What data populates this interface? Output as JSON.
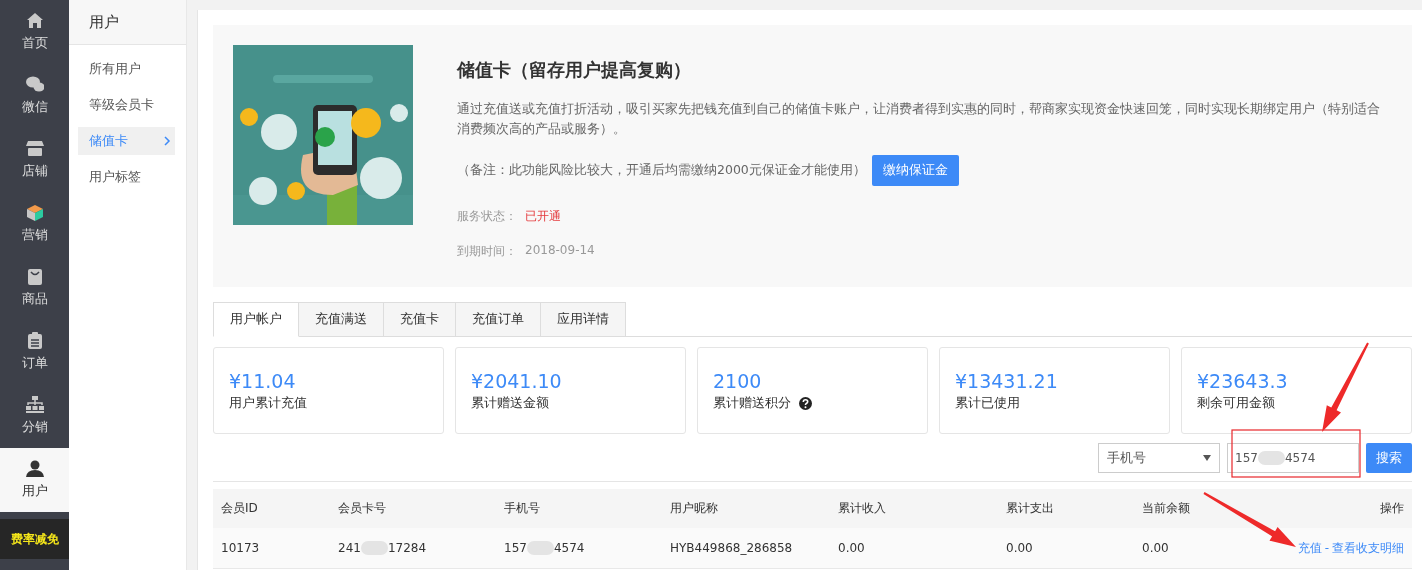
{
  "nav": [
    {
      "label": "首页",
      "selected": false
    },
    {
      "label": "微信",
      "selected": false
    },
    {
      "label": "店铺",
      "selected": false
    },
    {
      "label": "营销",
      "selected": false
    },
    {
      "label": "商品",
      "selected": false
    },
    {
      "label": "订单",
      "selected": false
    },
    {
      "label": "分销",
      "selected": false
    },
    {
      "label": "用户",
      "selected": true
    }
  ],
  "promo": {
    "label": "费率减免"
  },
  "subnav": {
    "title": "用户",
    "items": [
      {
        "label": "所有用户",
        "selected": false
      },
      {
        "label": "等级会员卡",
        "selected": false
      },
      {
        "label": "储值卡",
        "selected": true
      },
      {
        "label": "用户标签",
        "selected": false
      }
    ]
  },
  "intro": {
    "title": "储值卡（留存用户提高复购）",
    "description": "通过充值送或充值打折活动，吸引买家先把钱充值到自己的储值卡账户，让消费者得到实惠的同时，帮商家实现资金快速回笼，同时实现长期绑定用户（特别适合消费频次高的产品或服务）。",
    "note": "（备注：此功能风险比较大，开通后均需缴纳2000元保证金才能使用）",
    "pay_button": "缴纳保证金",
    "status_label": "服务状态：",
    "status_value": "已开通",
    "expiry_label": "到期时间：",
    "expiry_value": "2018-09-14"
  },
  "tabs": [
    {
      "label": "用户帐户",
      "selected": true
    },
    {
      "label": "充值满送",
      "selected": false
    },
    {
      "label": "充值卡",
      "selected": false
    },
    {
      "label": "充值订单",
      "selected": false
    },
    {
      "label": "应用详情",
      "selected": false
    }
  ],
  "stats": [
    {
      "value": "¥11.04",
      "label": "用户累计充值",
      "help": false
    },
    {
      "value": "¥2041.10",
      "label": "累计赠送金额",
      "help": false
    },
    {
      "value": "2100",
      "label": "累计赠送积分",
      "help": true
    },
    {
      "value": "¥13431.21",
      "label": "累计已使用",
      "help": false
    },
    {
      "value": "¥23643.3",
      "label": "剩余可用金额",
      "help": false
    }
  ],
  "search": {
    "filter": "手机号",
    "query_parts": [
      "157",
      "4574"
    ],
    "button": "搜索"
  },
  "table": {
    "columns": [
      "会员ID",
      "会员卡号",
      "手机号",
      "用户昵称",
      "累计收入",
      "累计支出",
      "当前余额",
      "操作"
    ],
    "rows": [
      {
        "cells": [
          {
            "parts": [
              "10173"
            ]
          },
          {
            "parts": [
              "241",
              "17284"
            ]
          },
          {
            "parts": [
              "157",
              "4574"
            ]
          },
          {
            "parts": [
              "HYB449868_286858"
            ]
          },
          {
            "parts": [
              "0.00"
            ]
          },
          {
            "parts": [
              "0.00"
            ]
          },
          {
            "parts": [
              "0.00"
            ]
          }
        ],
        "actions": [
          "充值",
          "查看收支明细"
        ],
        "action_separator": "-"
      }
    ]
  },
  "annotations": [
    {
      "kind": "highlight-box"
    },
    {
      "kind": "arrow"
    },
    {
      "kind": "arrow"
    }
  ]
}
